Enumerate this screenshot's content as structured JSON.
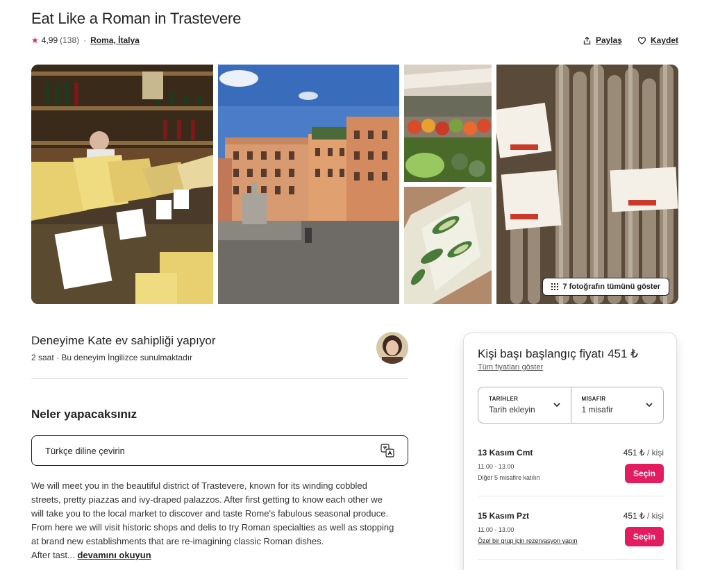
{
  "listing": {
    "title": "Eat Like a Roman in Trastevere",
    "rating": "4,99",
    "reviews": "(138)",
    "location": "Roma, İtalya"
  },
  "actions": {
    "share": "Paylaş",
    "save": "Kaydet"
  },
  "gallery": {
    "show_all": "7 fotoğrafın tümünü göster",
    "photos": [
      "cheese-shop-photo",
      "piazza-photo",
      "market-stall-photo",
      "pizza-photo",
      "salami-photo"
    ]
  },
  "host": {
    "title": "Deneyime Kate ev sahipliği yapıyor",
    "subtitle": "2 saat · Bu deneyim İngilizce sunulmaktadır"
  },
  "about": {
    "title": "Neler yapacaksınız",
    "translate": "Türkçe diline çevirin",
    "lines": [
      "We will meet you in the beautiful district of Trastevere, known for its winding cobbled",
      "streets, pretty piazzas and ivy-draped palazzos. After first getting to know each other we",
      "will take you to the local market to discover and taste Rome's fabulous seasonal produce.",
      "From here we will visit historic shops and delis to try Roman specialties as well as stopping",
      "at brand new establishments that are re-imagining classic Roman dishes."
    ],
    "last_prefix": "After tast... ",
    "read_more": "devamını okuyun"
  },
  "booking": {
    "price_title": "Kişi başı başlangıç fiyatı 451 ₺",
    "all_prices": "Tüm fiyatları göster",
    "dates_label": "TARİHLER",
    "dates_value": "Tarih ekleyin",
    "guests_label": "MİSAFİR",
    "guests_value": "1 misafir",
    "slots": [
      {
        "date": "13 Kasım Cmt",
        "time": "11.00 - 13.00",
        "note": "Diğer 5 misafire katılın",
        "price": "451 ₺",
        "unit": " / kişi",
        "button": "Seçin"
      },
      {
        "date": "15 Kasım Pzt",
        "time": "11.00 - 13.00",
        "note": "Özel bir grup için rezervasyon yapın",
        "price": "451 ₺",
        "unit": " / kişi",
        "button": "Seçin"
      }
    ]
  },
  "colors": {
    "accent": "#e31c5f",
    "star": "#e0215a",
    "text": "#222222"
  }
}
